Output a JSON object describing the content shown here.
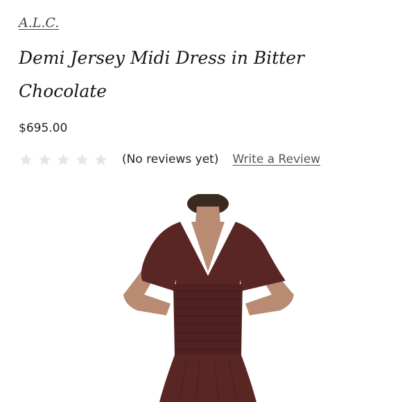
{
  "product": {
    "brand": "A.L.C.",
    "title": "Demi Jersey Midi Dress in Bitter Chocolate",
    "price": "$695.00"
  },
  "reviews": {
    "rating": 0,
    "max_rating": 5,
    "count_text": "(No reviews yet)",
    "write_review_label": "Write a Review",
    "star_color_empty": "#e6e6e6"
  },
  "image": {
    "dress_color": "#5a2624",
    "skin_color": "#b98b73"
  }
}
